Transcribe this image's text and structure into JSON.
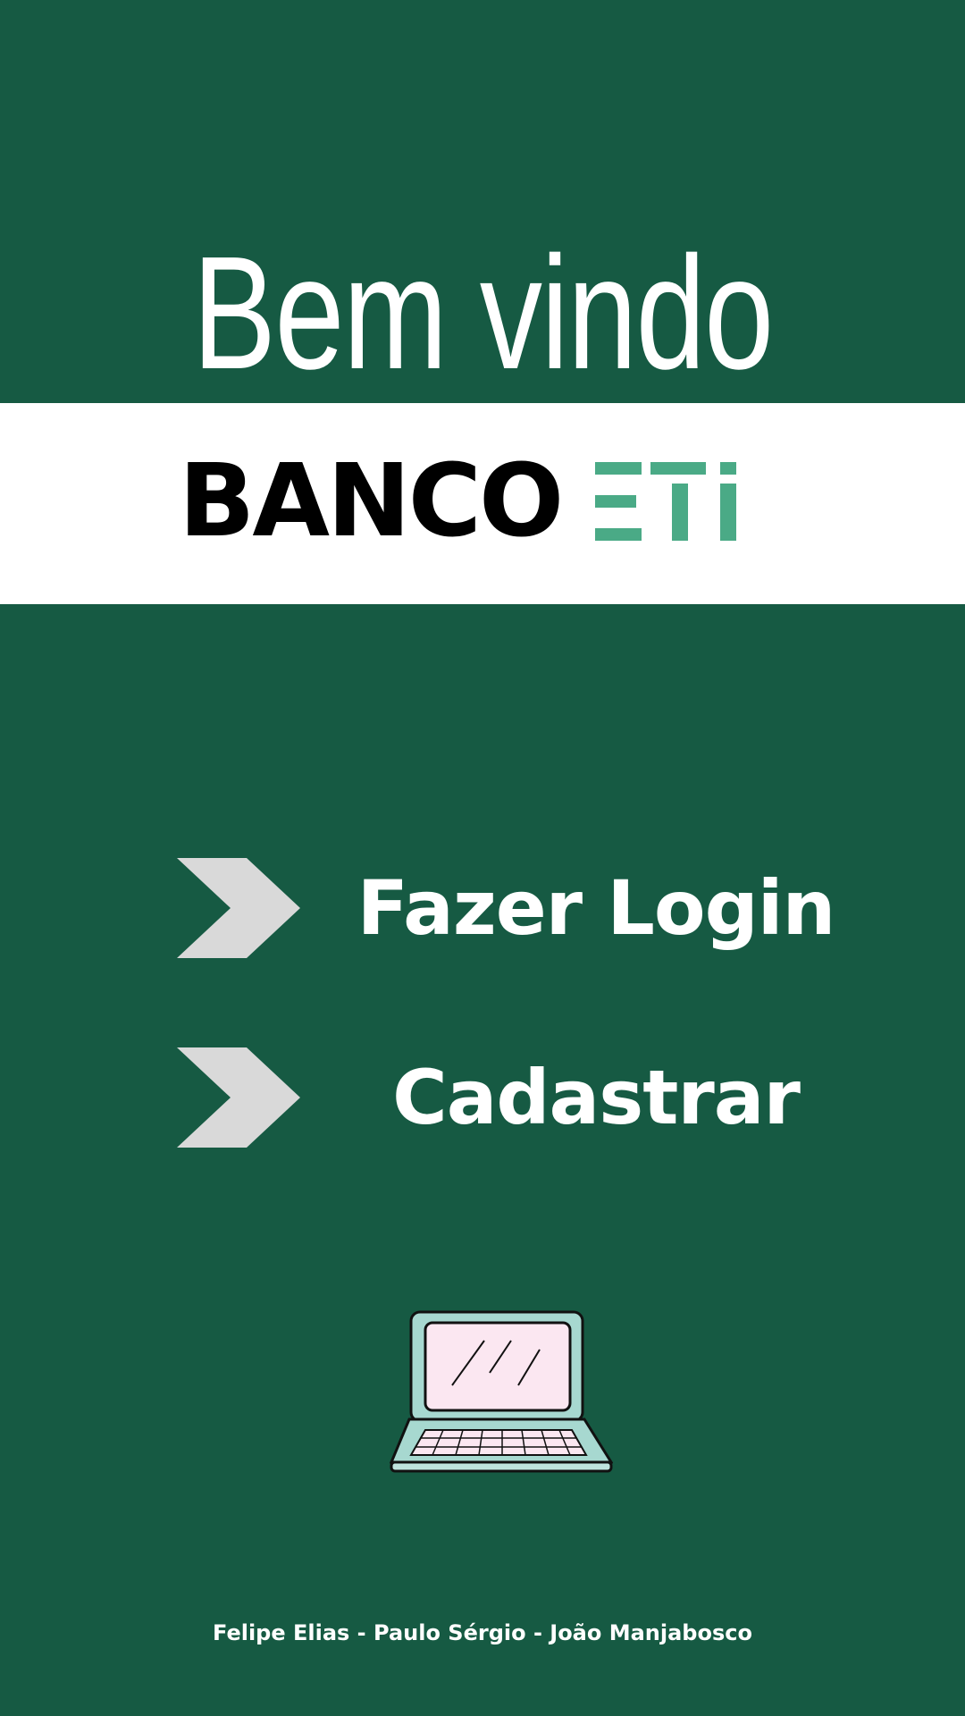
{
  "header": {
    "title": "Bem vindo"
  },
  "brand": {
    "name": "BANCO",
    "mark_text": "ETi",
    "mark_color": "#4aaa86"
  },
  "menu": {
    "items": [
      {
        "label": "Fazer Login",
        "icon": "chevron-right-icon"
      },
      {
        "label": "Cadastrar",
        "icon": "chevron-right-icon"
      }
    ]
  },
  "illustration": {
    "icon": "laptop-icon"
  },
  "footer": {
    "credits": "Felipe Elias - Paulo Sérgio - João Manjabosco"
  },
  "colors": {
    "background": "#165a43",
    "band": "#ffffff",
    "chevron": "#d9d9d9",
    "text": "#ffffff"
  }
}
